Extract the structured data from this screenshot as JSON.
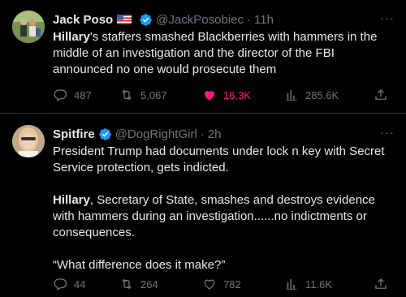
{
  "tweets": [
    {
      "name": "Jack Poso",
      "handle": "@JackPosobiec",
      "time": "11h",
      "text_bold": "Hillary",
      "text_rest": "'s staffers smashed Blackberries with hammers in the middle of an investigation and the director of the FBI announced no one would prosecute them",
      "replies": "487",
      "retweets": "5,067",
      "likes": "16.3K",
      "views": "285.6K",
      "liked": true
    },
    {
      "name": "Spitfire",
      "handle": "@DogRightGirl",
      "time": "2h",
      "para1": "President Trump had documents under lock n key with Secret Service protection, gets indicted.",
      "para2_bold": "Hillary",
      "para2_rest": ", Secretary of State, smashes and destroys evidence with hammers during an investigation......no indictments or consequences.",
      "para3": "“What difference does it make?”",
      "replies": "44",
      "retweets": "264",
      "likes": "782",
      "views": "11.6K",
      "liked": false
    }
  ],
  "more_label": "···",
  "dot": "·",
  "colors": {
    "verified": "#1d9bf0",
    "liked": "#f91880",
    "muted": "#71767b",
    "border": "#2f3336"
  }
}
